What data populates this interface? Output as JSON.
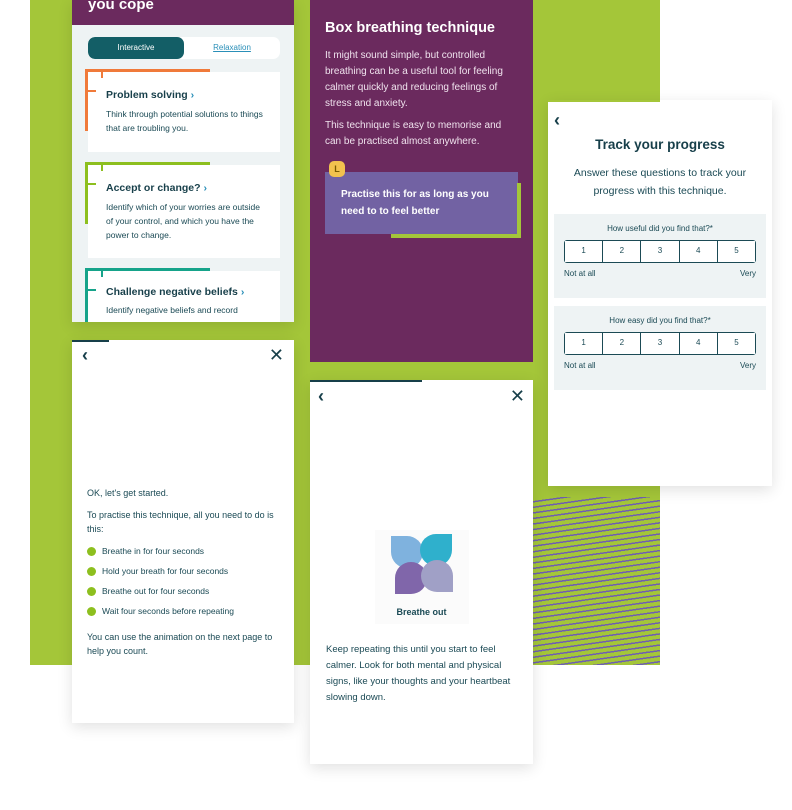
{
  "colors": {
    "background": "#a4c639",
    "purple": "#6b2a5e",
    "teal": "#135e66",
    "tip": "#7262a3"
  },
  "coping": {
    "title": "you cope",
    "tabs": [
      {
        "label": "Interactive",
        "active": true
      },
      {
        "label": "Relaxation",
        "active": false
      }
    ],
    "cards": [
      {
        "title": "Problem solving",
        "desc": "Think through potential solutions to things that are troubling you.",
        "color": "#f07a3a"
      },
      {
        "title": "Accept or change?",
        "desc": "Identify which of your worries are outside of your control, and which you have the power to change.",
        "color": "#8dbf1f"
      },
      {
        "title": "Challenge negative beliefs",
        "desc": "Identify negative beliefs and record",
        "color": "#16a38a"
      }
    ],
    "chevron": "›"
  },
  "technique": {
    "title": "Box breathing technique",
    "p1": "It might sound simple, but controlled breathing can be a useful tool for feeling calmer quickly and reducing feelings of stress and anxiety.",
    "p2": "This technique is easy to memorise and can be practised almost anywhere.",
    "tip": "Practise this for as long as you need to to feel better",
    "tip_icon": "alarm-clock-icon"
  },
  "progress": {
    "back": "‹",
    "title": "Track your progress",
    "intro": "Answer these questions to track your progress with this technique.",
    "questions": [
      {
        "label": "How useful did you find that?*",
        "options": [
          "1",
          "2",
          "3",
          "4",
          "5"
        ],
        "low": "Not at all",
        "high": "Very"
      },
      {
        "label": "How easy did you find that?*",
        "options": [
          "1",
          "2",
          "3",
          "4",
          "5"
        ],
        "low": "Not at all",
        "high": "Very"
      }
    ]
  },
  "steps": {
    "back": "‹",
    "close": "✕",
    "intro": "OK, let's get started.",
    "lead": "To practise this technique, all you need to do is this:",
    "items": [
      "Breathe in for four seconds",
      "Hold your breath for four seconds",
      "Breathe out for four seconds",
      "Wait four seconds before repeating"
    ],
    "outro": "You can use the animation on the next page to help you count."
  },
  "animation": {
    "back": "‹",
    "close": "✕",
    "label": "Breathe out",
    "text": "Keep repeating this until you start to feel calmer. Look for both mental and physical signs, like your thoughts and your heartbeat slowing down."
  }
}
